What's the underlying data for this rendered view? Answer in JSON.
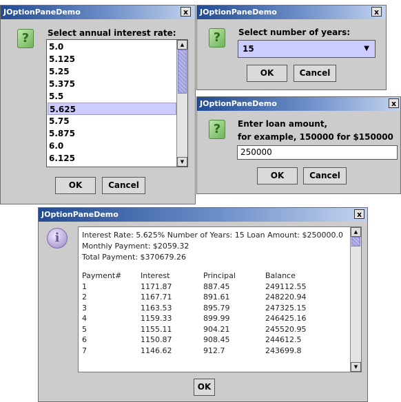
{
  "rate_dialog": {
    "title": "JOptionPaneDemo",
    "close": "x",
    "icon": "question-icon",
    "prompt": "Select annual interest rate:",
    "rates": [
      "5.0",
      "5.125",
      "5.25",
      "5.375",
      "5.5",
      "5.625",
      "5.75",
      "5.875",
      "6.0",
      "6.125"
    ],
    "selected_rate": "5.625",
    "ok": "OK",
    "cancel": "Cancel"
  },
  "years_dialog": {
    "title": "JOptionPaneDemo",
    "close": "x",
    "icon": "question-icon",
    "prompt": "Select number of years:",
    "selected_value": "15",
    "ok": "OK",
    "cancel": "Cancel"
  },
  "loan_dialog": {
    "title": "JOptionPaneDemo",
    "close": "x",
    "icon": "question-icon",
    "prompt_line1": "Enter loan amount,",
    "prompt_line2": "for example, 150000 for $150000",
    "input_value": "250000",
    "ok": "OK",
    "cancel": "Cancel"
  },
  "result_dialog": {
    "title": "JOptionPaneDemo",
    "close": "x",
    "icon": "info-icon",
    "summary": "Interest Rate: 5.625% Number of Years: 15 Loan Amount: $250000.0",
    "monthly": "Monthly Payment: $2059.32",
    "total": "Total Payment: $370679.26",
    "headers": [
      "Payment#",
      "Interest",
      "Principal",
      "Balance"
    ],
    "rows": [
      [
        "1",
        "1171.87",
        "887.45",
        "249112.55"
      ],
      [
        "2",
        "1167.71",
        "891.61",
        "248220.94"
      ],
      [
        "3",
        "1163.53",
        "895.79",
        "247325.15"
      ],
      [
        "4",
        "1159.33",
        "899.99",
        "246425.16"
      ],
      [
        "5",
        "1155.11",
        "904.21",
        "245520.95"
      ],
      [
        "6",
        "1150.87",
        "908.45",
        "244612.5"
      ],
      [
        "7",
        "1146.62",
        "912.7",
        "243699.8"
      ]
    ],
    "ok": "OK"
  }
}
